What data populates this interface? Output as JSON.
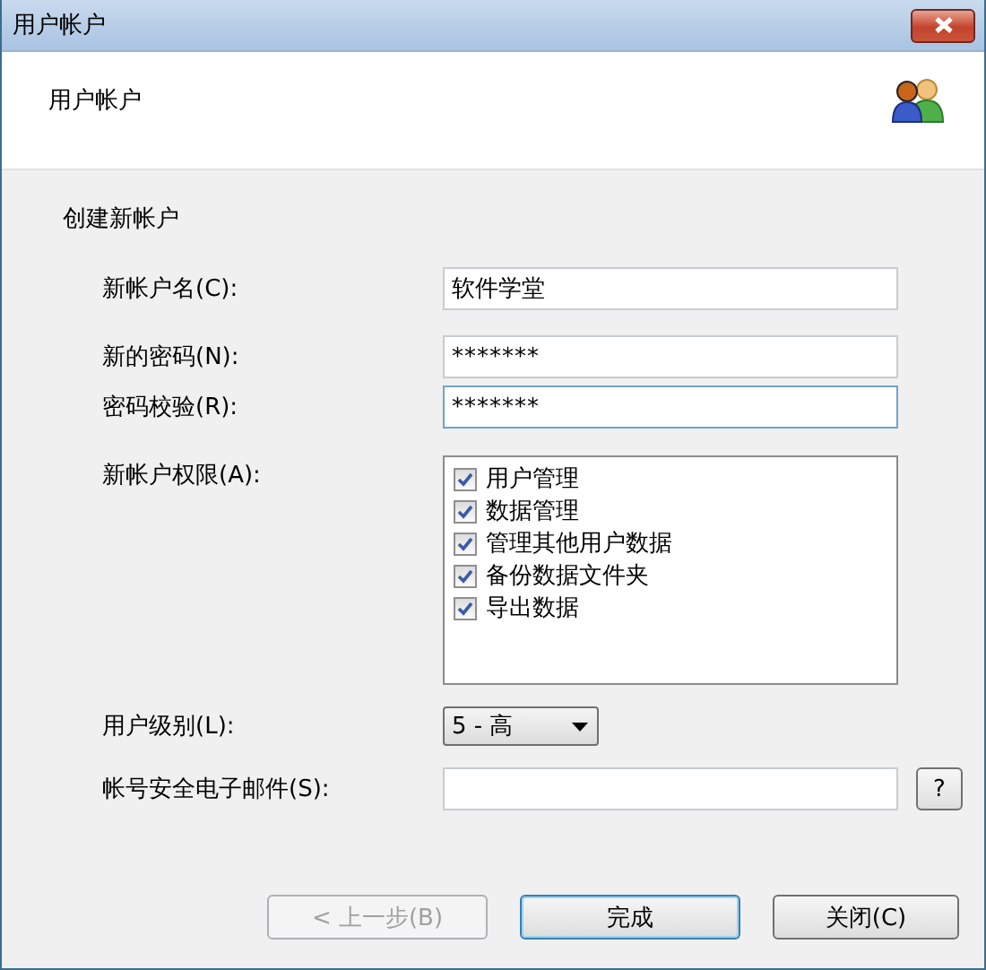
{
  "window": {
    "title": "用户帐户"
  },
  "header": {
    "title": "用户帐户"
  },
  "section": {
    "title": "创建新帐户"
  },
  "fields": [
    {
      "kind": "text",
      "label": "新帐户名(C):",
      "value": "软件学堂",
      "focused": false
    },
    {
      "kind": "password",
      "label": "新的密码(N):",
      "value": "*******",
      "focused": false
    },
    {
      "kind": "password",
      "label": "密码校验(R):",
      "value": "*******",
      "focused": true
    }
  ],
  "permissions": {
    "label": "新帐户权限(A):",
    "items": [
      {
        "label": "用户管理",
        "checked": true
      },
      {
        "label": "数据管理",
        "checked": true
      },
      {
        "label": "管理其他用户数据",
        "checked": true
      },
      {
        "label": "备份数据文件夹",
        "checked": true
      },
      {
        "label": "导出数据",
        "checked": true
      }
    ]
  },
  "level": {
    "label": "用户级别(L):",
    "value": "5 - 高"
  },
  "email": {
    "label": "帐号安全电子邮件(S):",
    "help": "?"
  },
  "buttons": [
    {
      "label": "< 上一步(B)",
      "disabled": true,
      "default": false
    },
    {
      "label": "完成",
      "disabled": false,
      "default": true
    },
    {
      "label": "关闭(C)",
      "disabled": false,
      "default": false
    }
  ]
}
